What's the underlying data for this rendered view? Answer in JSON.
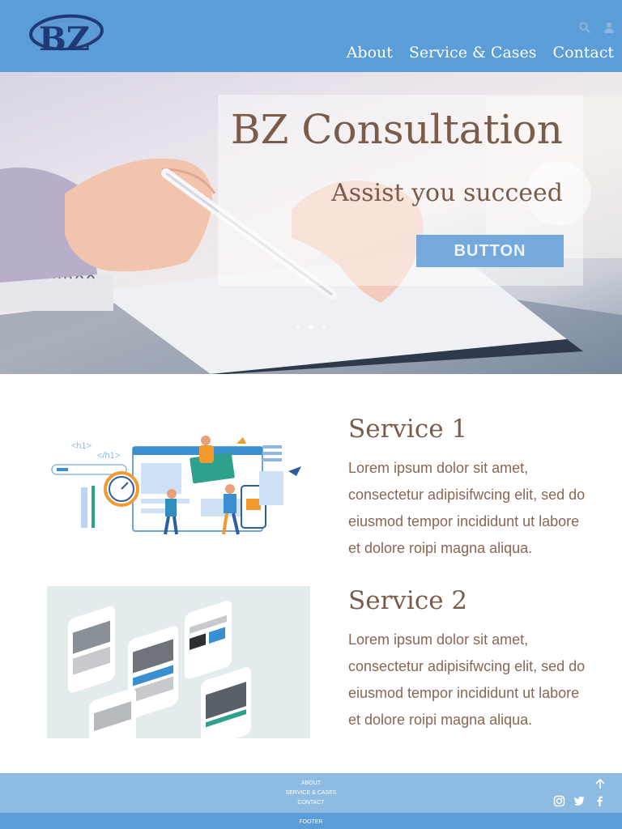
{
  "header": {
    "logo_text": "BZ",
    "icons": [
      "search-icon",
      "user-icon"
    ],
    "nav": [
      "About",
      "Service & Cases",
      "Contact"
    ]
  },
  "hero": {
    "title": "BZ Consultation",
    "subtitle": "Assist you succeed",
    "button_label": "BUTTON",
    "slides": 3,
    "active_slide": 1
  },
  "services": [
    {
      "title": "Service 1",
      "text": "Lorem ipsum dolor sit amet, consectetur adipisifwcing elit, sed do eiusmod tempor incididunt ut labore et dolore roipi magna aliqua."
    },
    {
      "title": "Service 2",
      "text": "Lorem ipsum dolor sit amet, consectetur adipisifwcing elit, sed do eiusmod tempor incididunt ut labore et dolore roipi magna aliqua."
    }
  ],
  "illustration": {
    "code_tags": [
      "<h1>",
      "</h1>"
    ]
  },
  "footer": {
    "links": [
      "ABOUT",
      "SERVICE & CASES",
      "CONTACT"
    ],
    "social_icons": [
      "instagram-icon",
      "twitter-icon",
      "facebook-icon"
    ],
    "bottom_label": "FOOTER"
  },
  "colors": {
    "header_bg": "#5b9dd6",
    "footer_bg": "#8ebbe1",
    "text_brown": "#7a5c4b",
    "button_bg": "#75a9dc"
  }
}
